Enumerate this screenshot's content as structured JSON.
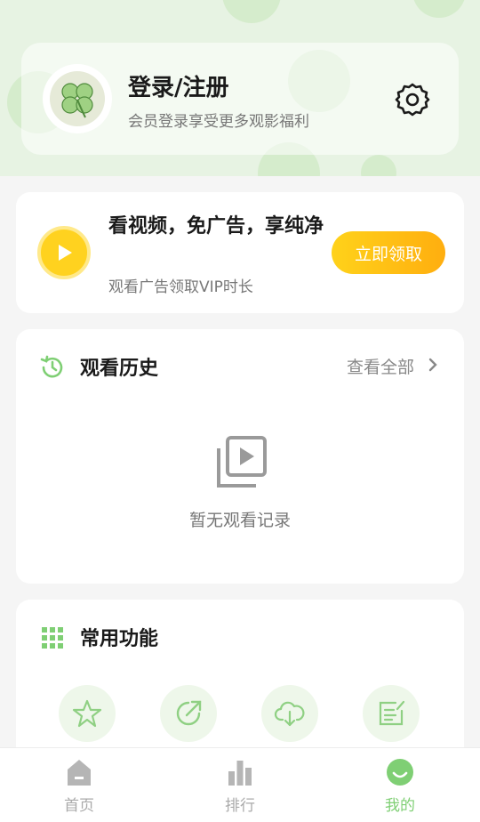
{
  "profile": {
    "title": "登录/注册",
    "subtitle": "会员登录享受更多观影福利"
  },
  "promo": {
    "title": "看视频，免广告，享纯净",
    "subtitle": "观看广告领取VIP时长",
    "button_label": "立即领取"
  },
  "history": {
    "title": "观看历史",
    "view_all_label": "查看全部",
    "empty_text": "暂无观看记录"
  },
  "functions": {
    "title": "常用功能",
    "items": [
      {
        "icon": "star-icon"
      },
      {
        "icon": "share-icon"
      },
      {
        "icon": "cloud-download-icon"
      },
      {
        "icon": "feedback-icon"
      }
    ]
  },
  "tabbar": {
    "items": [
      {
        "label": "首页",
        "icon": "home-icon",
        "active": false
      },
      {
        "label": "排行",
        "icon": "ranking-icon",
        "active": false
      },
      {
        "label": "我的",
        "icon": "profile-smile-icon",
        "active": true
      }
    ]
  },
  "colors": {
    "accent_green": "#7fcf74",
    "accent_yellow": "#ffd21f",
    "hero_bg": "#e7f3e3"
  }
}
